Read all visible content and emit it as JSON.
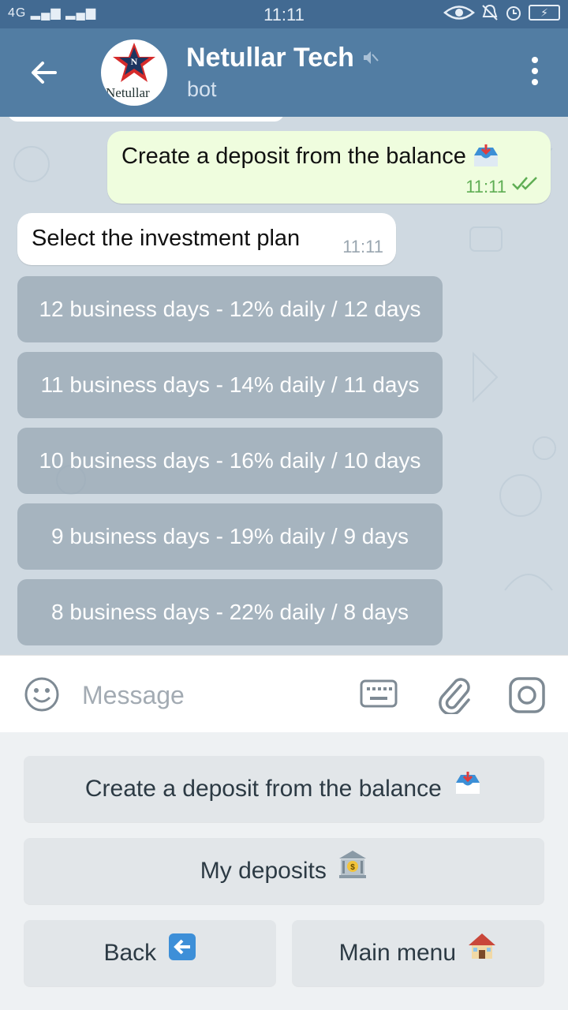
{
  "status_bar": {
    "network": "4G",
    "time": "11:11",
    "icons": [
      "eye-icon",
      "mute-bell-icon",
      "alarm-icon",
      "battery-charging-icon"
    ]
  },
  "header": {
    "back_icon": "arrow-left-icon",
    "avatar_text": "Netullar",
    "title": "Netullar Tech",
    "muted_icon": "speaker-muted-icon",
    "subtitle": "bot",
    "menu_icon": "more-vertical-icon"
  },
  "messages": [
    {
      "direction": "outgoing",
      "text": "Create a deposit from the balance",
      "emoji": "inbox-tray-emoji",
      "time": "11:11",
      "status": "read"
    },
    {
      "direction": "incoming",
      "text": "Select the investment plan",
      "time": "11:11"
    }
  ],
  "inline_buttons": [
    "12 business days - 12% daily / 12 days",
    "11 business days - 14% daily / 11 days",
    "10 business days - 16% daily / 10 days",
    "9 business days - 19% daily / 9 days",
    "8 business days - 22% daily / 8 days"
  ],
  "composer": {
    "placeholder": "Message",
    "icons": [
      "smile-icon",
      "keyboard-icon",
      "paperclip-icon",
      "camera-icon"
    ]
  },
  "reply_keyboard": {
    "row1": {
      "label": "Create a deposit from the balance",
      "emoji": "inbox-tray-emoji"
    },
    "row2": {
      "label": "My deposits",
      "emoji": "bank-emoji"
    },
    "row3": [
      {
        "label": "Back",
        "emoji": "back-arrow-emoji"
      },
      {
        "label": "Main menu",
        "emoji": "house-emoji"
      }
    ]
  },
  "colors": {
    "header": "#527da3",
    "status_bar": "#426a92",
    "chat_background": "#cfd9e1",
    "outgoing_bubble": "#effdde",
    "incoming_bubble": "#ffffff",
    "inline_button": "#96a5b2",
    "reply_keyboard_bg": "#eef1f3",
    "reply_button": "#e2e6e9",
    "read_check": "#5fae54"
  }
}
